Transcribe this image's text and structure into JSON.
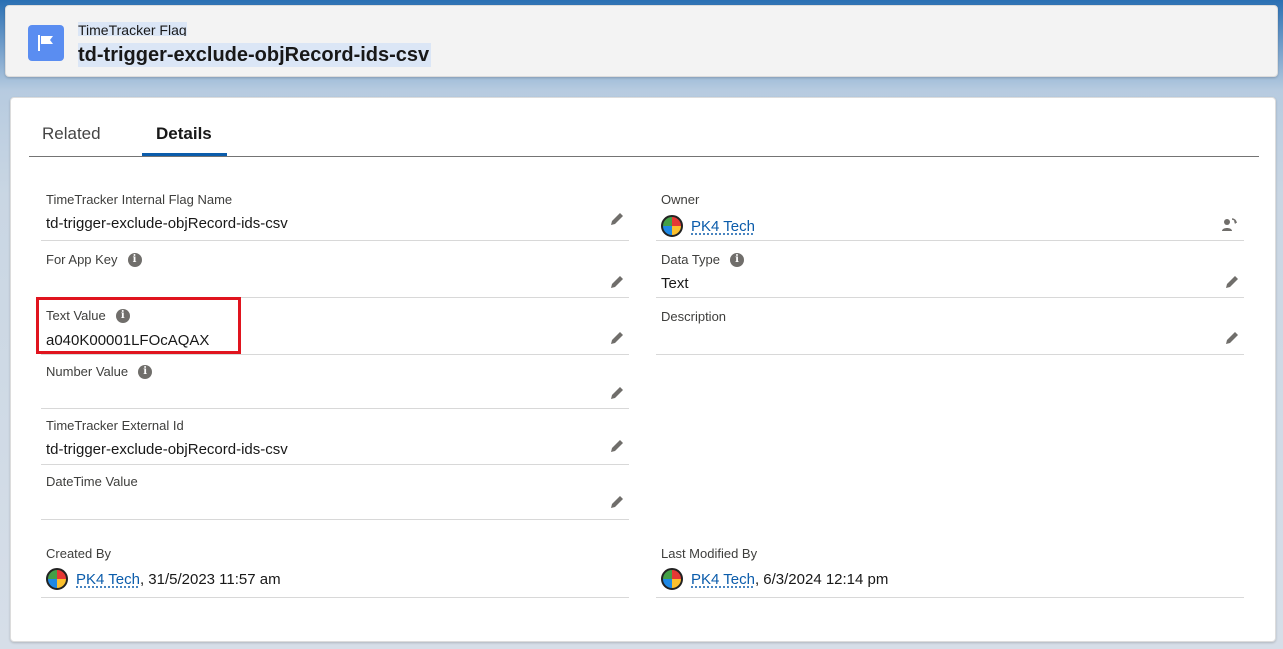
{
  "header": {
    "object_label": "TimeTracker Flag",
    "record_title": "td-trigger-exclude-objRecord-ids-csv",
    "icon": "flag-icon"
  },
  "tabs": [
    {
      "label": "Related",
      "active": false
    },
    {
      "label": "Details",
      "active": true
    }
  ],
  "fields": {
    "internal_flag_name": {
      "label": "TimeTracker Internal Flag Name",
      "value": "td-trigger-exclude-objRecord-ids-csv"
    },
    "owner": {
      "label": "Owner",
      "value": "PK4 Tech"
    },
    "for_app_key": {
      "label": "For App Key",
      "value": ""
    },
    "data_type": {
      "label": "Data Type",
      "value": "Text"
    },
    "text_value": {
      "label": "Text Value",
      "value": "a040K00001LFOcAQAX"
    },
    "description": {
      "label": "Description",
      "value": ""
    },
    "number_value": {
      "label": "Number Value",
      "value": ""
    },
    "external_id": {
      "label": "TimeTracker External Id",
      "value": "td-trigger-exclude-objRecord-ids-csv"
    },
    "datetime_value": {
      "label": "DateTime Value",
      "value": ""
    },
    "created_by": {
      "label": "Created By",
      "user": "PK4 Tech",
      "timestamp": ", 31/5/2023 11:57 am"
    },
    "last_modified_by": {
      "label": "Last Modified By",
      "user": "PK4 Tech",
      "timestamp": ", 6/3/2024 12:14 pm"
    }
  },
  "colors": {
    "brand_blue": "#0b5cab",
    "icon_blue": "#5a8df1",
    "highlight_red": "#e0141e"
  }
}
